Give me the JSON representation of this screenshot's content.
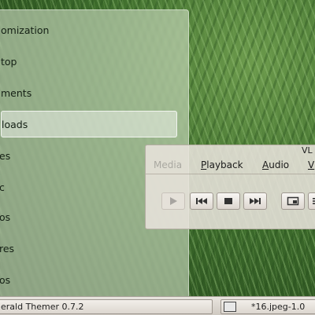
{
  "places": [
    {
      "label": "omization"
    },
    {
      "label": "top"
    },
    {
      "label": "ments"
    },
    {
      "label": "loads",
      "selected": true
    },
    {
      "label": "es"
    },
    {
      "label": "c"
    },
    {
      "label": "os"
    },
    {
      "label": "res"
    },
    {
      "label": "os"
    }
  ],
  "vlc": {
    "title": "VL",
    "menus": [
      {
        "label": "Media",
        "faded": true
      },
      {
        "label": "Playback"
      },
      {
        "label": "Audio"
      },
      {
        "label": "V"
      }
    ],
    "controls": [
      "play-icon",
      "previous-icon",
      "stop-icon",
      "next-icon",
      "fullscreen-icon",
      "playlist-icon"
    ]
  },
  "taskbar": {
    "items": [
      {
        "label": "erald Themer 0.7.2"
      },
      {
        "label": "*16.jpeg-1.0"
      }
    ]
  }
}
